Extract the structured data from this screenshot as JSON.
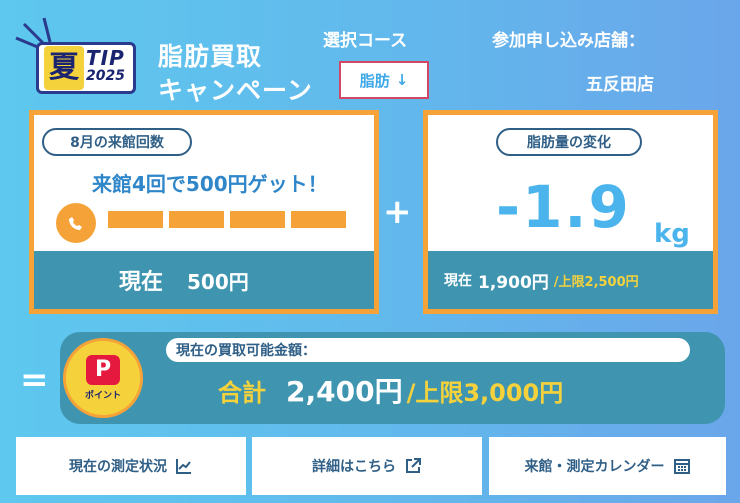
{
  "header": {
    "logo": {
      "char": "夏",
      "tip": "TIP",
      "year": "2025"
    },
    "title_line1": "脂肪買取",
    "title_line2": "キャンペーン",
    "course_label": "選択コース",
    "course_selected": "脂肪",
    "course_arrow": "↓",
    "store_label": "参加申し込み店舗：",
    "store_value": "五反田店"
  },
  "visit_panel": {
    "pill": "8月の来館回数",
    "goal_text": "来館4回で500円ゲット！",
    "progress_segments": 4,
    "progress_filled": 4,
    "current_label": "現在",
    "current_value": "500円"
  },
  "plus_sign": "+",
  "fat_panel": {
    "pill": "脂肪量の変化",
    "value": "-1.9",
    "unit": "kg",
    "now_label": "現在",
    "now_value": "1,900円",
    "limit": "/上限2,500円"
  },
  "equals_sign": "=",
  "total": {
    "icon_label": "ポイント",
    "header": "現在の買取可能金額：",
    "label": "合計",
    "amount": "2,400円",
    "limit": "/上限3,000円"
  },
  "buttons": {
    "status": "現在の測定状況",
    "details": "詳細はこちら",
    "calendar": "来館・測定カレンダー"
  },
  "colors": {
    "accent_orange": "#f5a238",
    "panel_teal": "#3f95b0",
    "highlight_yellow": "#f5d23c",
    "value_blue": "#4bb4ec",
    "select_border": "#d04863"
  }
}
